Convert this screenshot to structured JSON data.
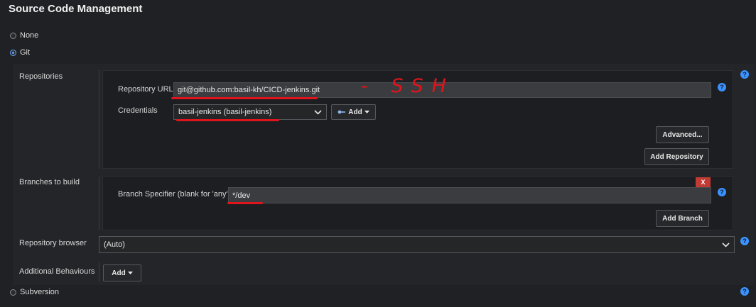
{
  "section_title": "Source Code Management",
  "scm_options": {
    "none": "None",
    "git": "Git",
    "subversion": "Subversion"
  },
  "repositories": {
    "label": "Repositories",
    "url_label": "Repository URL",
    "url_value": "git@github.com:basil-kh/CICD-jenkins.git",
    "credentials_label": "Credentials",
    "credentials_value": "basil-jenkins (basil-jenkins)",
    "add_label": "Add",
    "advanced_label": "Advanced...",
    "add_repository_label": "Add Repository"
  },
  "branches": {
    "label": "Branches to build",
    "specifier_label": "Branch Specifier (blank for 'any')",
    "specifier_value": "*/dev",
    "delete_label": "X",
    "add_branch_label": "Add Branch"
  },
  "repo_browser": {
    "label": "Repository browser",
    "value": "(Auto)"
  },
  "additional": {
    "label": "Additional Behaviours",
    "add_label": "Add"
  },
  "annotation": {
    "text": "- SSH"
  },
  "colors": {
    "accent": "#3c93ff",
    "danger": "#c23a34",
    "annotation_red": "#e0141c"
  }
}
